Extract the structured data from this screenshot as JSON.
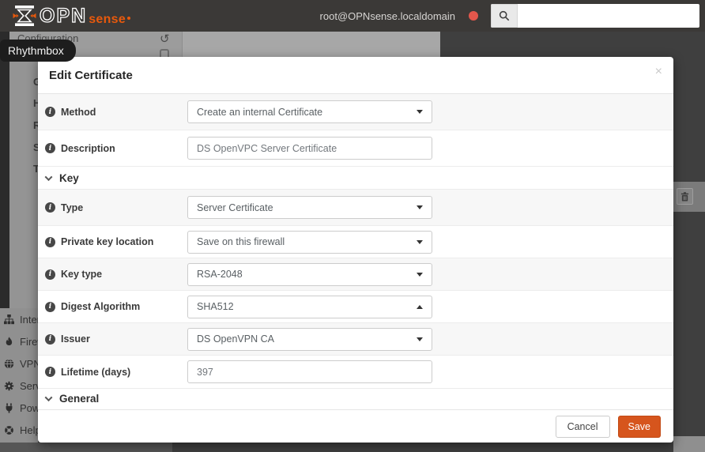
{
  "navbar": {
    "logo": {
      "opn": "OPN",
      "sense": "sense"
    },
    "user": "root@OPNsense.localdomain",
    "search_value": ""
  },
  "desktop_tooltip": "Rhythmbox",
  "background": {
    "breadcrumb": "Configuration",
    "menu_letters": [
      "G",
      "H",
      "R",
      "S",
      "T"
    ],
    "sidebar": [
      {
        "icon": "sitemap-icon",
        "label": "Interfaces"
      },
      {
        "icon": "fire-icon",
        "label": "Firewall"
      },
      {
        "icon": "globe-icon",
        "label": "VPN"
      },
      {
        "icon": "gear-icon",
        "label": "Services"
      },
      {
        "icon": "plug-icon",
        "label": "Power"
      },
      {
        "icon": "life-ring-icon",
        "label": "Help"
      }
    ]
  },
  "modal": {
    "title": "Edit Certificate",
    "close": "×",
    "fields": {
      "method": {
        "label": "Method",
        "value": "Create an internal Certificate"
      },
      "description": {
        "label": "Description",
        "value": "DS OpenVPC Server Certificate"
      },
      "type": {
        "label": "Type",
        "value": "Server Certificate"
      },
      "private_key_location": {
        "label": "Private key location",
        "value": "Save on this firewall"
      },
      "key_type": {
        "label": "Key type",
        "value": "RSA-2048"
      },
      "digest_algorithm": {
        "label": "Digest Algorithm",
        "value": "SHA512"
      },
      "issuer": {
        "label": "Issuer",
        "value": "DS OpenVPN CA"
      },
      "lifetime": {
        "label": "Lifetime (days)",
        "value": "397"
      }
    },
    "sections": {
      "key": "Key",
      "general": "General"
    },
    "footer": {
      "cancel": "Cancel",
      "save": "Save"
    }
  },
  "colors": {
    "accent": "#d6551d",
    "navbar": "#3b3937",
    "logo_orange": "#e8590c",
    "alert_dot": "#e2574c"
  }
}
